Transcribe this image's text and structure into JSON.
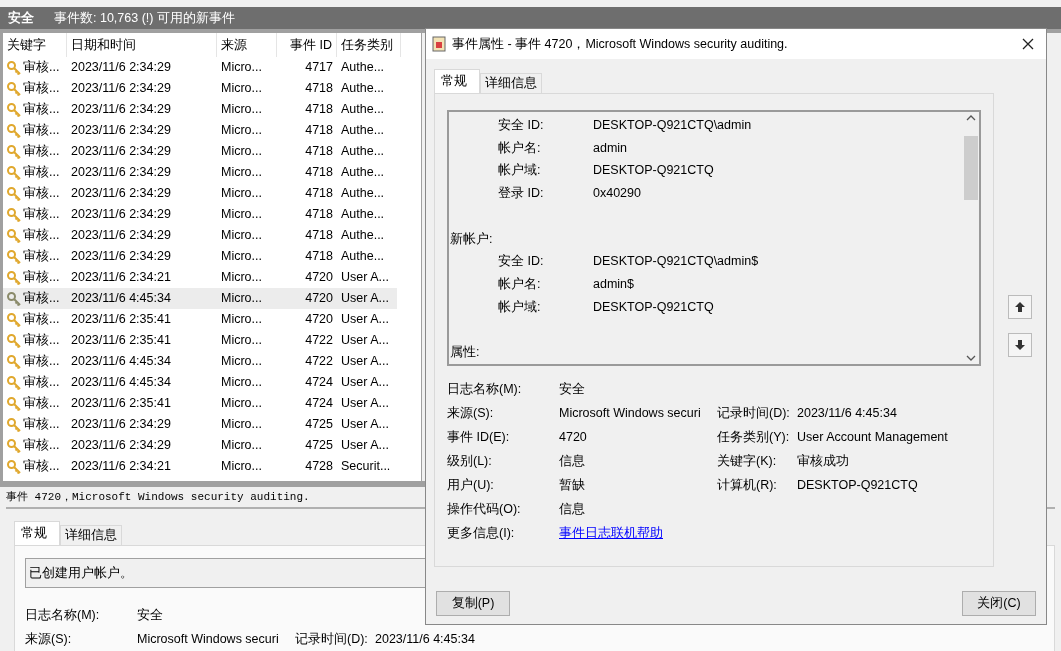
{
  "header": {
    "log_name": "安全",
    "count_text": "事件数: 10,763 (!) 可用的新事件"
  },
  "table": {
    "columns": [
      "关键字",
      "日期和时间",
      "来源",
      "事件 ID",
      "任务类别"
    ],
    "rows": [
      {
        "keyword": "审核...",
        "datetime": "2023/11/6 2:34:29",
        "source": "Micro...",
        "event_id": "4717",
        "task": "Authe...",
        "selected": false
      },
      {
        "keyword": "审核...",
        "datetime": "2023/11/6 2:34:29",
        "source": "Micro...",
        "event_id": "4718",
        "task": "Authe...",
        "selected": false
      },
      {
        "keyword": "审核...",
        "datetime": "2023/11/6 2:34:29",
        "source": "Micro...",
        "event_id": "4718",
        "task": "Authe...",
        "selected": false
      },
      {
        "keyword": "审核...",
        "datetime": "2023/11/6 2:34:29",
        "source": "Micro...",
        "event_id": "4718",
        "task": "Authe...",
        "selected": false
      },
      {
        "keyword": "审核...",
        "datetime": "2023/11/6 2:34:29",
        "source": "Micro...",
        "event_id": "4718",
        "task": "Authe...",
        "selected": false
      },
      {
        "keyword": "审核...",
        "datetime": "2023/11/6 2:34:29",
        "source": "Micro...",
        "event_id": "4718",
        "task": "Authe...",
        "selected": false
      },
      {
        "keyword": "审核...",
        "datetime": "2023/11/6 2:34:29",
        "source": "Micro...",
        "event_id": "4718",
        "task": "Authe...",
        "selected": false
      },
      {
        "keyword": "审核...",
        "datetime": "2023/11/6 2:34:29",
        "source": "Micro...",
        "event_id": "4718",
        "task": "Authe...",
        "selected": false
      },
      {
        "keyword": "审核...",
        "datetime": "2023/11/6 2:34:29",
        "source": "Micro...",
        "event_id": "4718",
        "task": "Authe...",
        "selected": false
      },
      {
        "keyword": "审核...",
        "datetime": "2023/11/6 2:34:29",
        "source": "Micro...",
        "event_id": "4718",
        "task": "Authe...",
        "selected": false
      },
      {
        "keyword": "审核...",
        "datetime": "2023/11/6 2:34:21",
        "source": "Micro...",
        "event_id": "4720",
        "task": "User A...",
        "selected": false
      },
      {
        "keyword": "审核...",
        "datetime": "2023/11/6 4:45:34",
        "source": "Micro...",
        "event_id": "4720",
        "task": "User A...",
        "selected": true
      },
      {
        "keyword": "审核...",
        "datetime": "2023/11/6 2:35:41",
        "source": "Micro...",
        "event_id": "4720",
        "task": "User A...",
        "selected": false
      },
      {
        "keyword": "审核...",
        "datetime": "2023/11/6 2:35:41",
        "source": "Micro...",
        "event_id": "4722",
        "task": "User A...",
        "selected": false
      },
      {
        "keyword": "审核...",
        "datetime": "2023/11/6 4:45:34",
        "source": "Micro...",
        "event_id": "4722",
        "task": "User A...",
        "selected": false
      },
      {
        "keyword": "审核...",
        "datetime": "2023/11/6 4:45:34",
        "source": "Micro...",
        "event_id": "4724",
        "task": "User A...",
        "selected": false
      },
      {
        "keyword": "审核...",
        "datetime": "2023/11/6 2:35:41",
        "source": "Micro...",
        "event_id": "4724",
        "task": "User A...",
        "selected": false
      },
      {
        "keyword": "审核...",
        "datetime": "2023/11/6 2:34:29",
        "source": "Micro...",
        "event_id": "4725",
        "task": "User A...",
        "selected": false
      },
      {
        "keyword": "审核...",
        "datetime": "2023/11/6 2:34:29",
        "source": "Micro...",
        "event_id": "4725",
        "task": "User A...",
        "selected": false
      },
      {
        "keyword": "审核...",
        "datetime": "2023/11/6 2:34:21",
        "source": "Micro...",
        "event_id": "4728",
        "task": "Securit...",
        "selected": false
      }
    ]
  },
  "preview": {
    "title": "事件 4720，Microsoft Windows security auditing.",
    "tabs": [
      {
        "label": "常规",
        "selected": true
      },
      {
        "label": "详细信息",
        "selected": false
      }
    ],
    "description": "已创建用户帐户。",
    "fields": [
      {
        "label": "日志名称(M):",
        "value": "安全"
      },
      {
        "label": "来源(S):",
        "value": "Microsoft Windows securi",
        "label2": "记录时间(D):",
        "value2": "2023/11/6 4:45:34"
      }
    ]
  },
  "dialog": {
    "title": "事件属性 - 事件 4720，Microsoft Windows security auditing.",
    "tabs": [
      {
        "label": "常规",
        "selected": true
      },
      {
        "label": "详细信息",
        "selected": false
      }
    ],
    "description_lines": [
      {
        "kind": "pair",
        "label": "安全 ID:",
        "value": "DESKTOP-Q921CTQ\\admin"
      },
      {
        "kind": "pair",
        "label": "帐户名:",
        "value": "admin"
      },
      {
        "kind": "pair",
        "label": "帐户域:",
        "value": "DESKTOP-Q921CTQ"
      },
      {
        "kind": "pair",
        "label": "登录 ID:",
        "value": "0x40290"
      },
      {
        "kind": "blank"
      },
      {
        "kind": "heading",
        "label": "新帐户:"
      },
      {
        "kind": "pair",
        "label": "安全 ID:",
        "value": "DESKTOP-Q921CTQ\\admin$"
      },
      {
        "kind": "pair",
        "label": "帐户名:",
        "value": "admin$"
      },
      {
        "kind": "pair",
        "label": "帐户域:",
        "value": "DESKTOP-Q921CTQ"
      },
      {
        "kind": "blank"
      },
      {
        "kind": "heading",
        "label": "属性:"
      }
    ],
    "fields": [
      {
        "label": "日志名称(M):",
        "value": "安全"
      },
      {
        "label": "来源(S):",
        "value": "Microsoft Windows securi",
        "label2": "记录时间(D):",
        "value2": "2023/11/6 4:45:34"
      },
      {
        "label": "事件 ID(E):",
        "value": "4720",
        "label2": "任务类别(Y):",
        "value2": "User Account Management"
      },
      {
        "label": "级别(L):",
        "value": "信息",
        "label2": "关键字(K):",
        "value2": "审核成功"
      },
      {
        "label": "用户(U):",
        "value": "暂缺",
        "label2": "计算机(R):",
        "value2": "DESKTOP-Q921CTQ"
      },
      {
        "label": "操作代码(O):",
        "value": "信息"
      },
      {
        "label": "更多信息(I):",
        "link": "事件日志联机帮助"
      }
    ],
    "buttons": {
      "copy": "复制(P)",
      "close": "关闭(C)"
    }
  }
}
